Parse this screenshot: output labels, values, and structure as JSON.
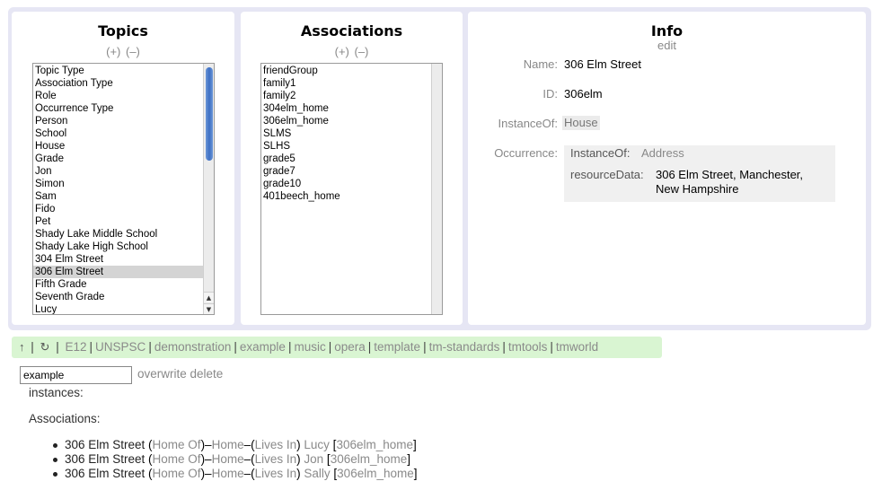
{
  "topics": {
    "title": "Topics",
    "add": "(+)",
    "remove": "(–)",
    "items": [
      "Topic Type",
      "Association Type",
      "Role",
      "Occurrence Type",
      "Person",
      "School",
      "House",
      "Grade",
      "Jon",
      "Simon",
      "Sam",
      "Fido",
      "Pet",
      "Shady Lake Middle School",
      "Shady Lake High School",
      "304 Elm Street",
      "306 Elm Street",
      "Fifth Grade",
      "Seventh Grade",
      "Lucy"
    ],
    "selected": "306 Elm Street"
  },
  "associations": {
    "title": "Associations",
    "add": "(+)",
    "remove": "(–)",
    "items": [
      "friendGroup",
      "family1",
      "family2",
      "304elm_home",
      "306elm_home",
      "SLMS",
      "SLHS",
      "grade5",
      "grade7",
      "grade10",
      "401beech_home"
    ]
  },
  "info": {
    "title": "Info",
    "edit": "edit",
    "name_label": "Name:",
    "name_value": "306 Elm Street",
    "id_label": "ID:",
    "id_value": "306elm",
    "instanceof_label": "InstanceOf:",
    "instanceof_value": "House",
    "occurrence_label": "Occurrence:",
    "occurrence": {
      "instanceof_key": "InstanceOf:",
      "instanceof_value": "Address",
      "resource_key": "resourceData:",
      "resource_line1": "306 Elm Street, Manchester,",
      "resource_line2": "New Hampshire"
    }
  },
  "navbar": {
    "up_icon": "↑",
    "refresh_icon": "↻",
    "links": [
      "E12",
      "UNSPSC",
      "demonstration",
      "example",
      "music",
      "opera",
      "template",
      "tm-standards",
      "tmtools",
      "tmworld"
    ]
  },
  "search": {
    "value": "example"
  },
  "actions": {
    "overwrite": "overwrite",
    "delete": "delete"
  },
  "instances_label": "instances:",
  "associations_label": "Associations:",
  "assoc_rows": [
    {
      "topic": "306 Elm Street",
      "role1": "Home Of",
      "type": "Home",
      "role2": "Lives In",
      "player": "Lucy",
      "id": "306elm_home"
    },
    {
      "topic": "306 Elm Street",
      "role1": "Home Of",
      "type": "Home",
      "role2": "Lives In",
      "player": "Jon",
      "id": "306elm_home"
    },
    {
      "topic": "306 Elm Street",
      "role1": "Home Of",
      "type": "Home",
      "role2": "Lives In",
      "player": "Sally",
      "id": "306elm_home"
    }
  ]
}
